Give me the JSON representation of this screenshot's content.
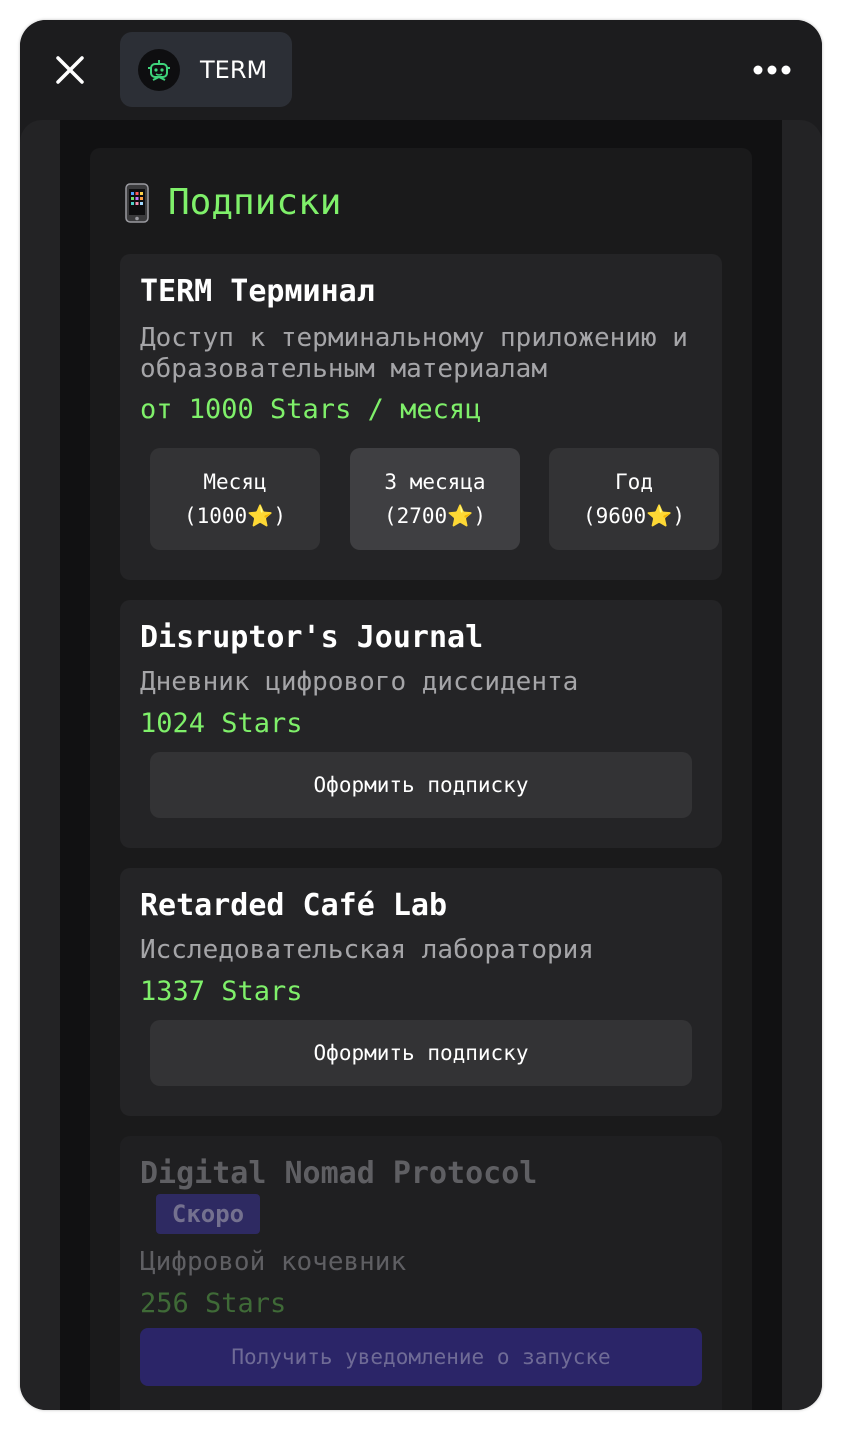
{
  "header": {
    "app_title": "TERM",
    "close_icon": "close-icon",
    "more_icon": "more-icon",
    "avatar_icon": "robot-avatar-icon"
  },
  "page": {
    "heading_icon": "mobile-phone-icon",
    "heading": "Подписки"
  },
  "colors": {
    "accent_green": "#7ff06a",
    "background": "#1a1a1b",
    "card": "#242426",
    "notify_button": "#2b2568"
  },
  "cards": [
    {
      "title": "TERM Терминал",
      "description": "Доступ к терминальному приложению и образовательным материалам",
      "price": "от 1000 Stars / месяц",
      "plans": [
        {
          "label": "Месяц",
          "price": "(1000⭐)"
        },
        {
          "label": "3 месяца",
          "price": "(2700⭐)",
          "selected": true
        },
        {
          "label": "Год",
          "price": "(9600⭐)"
        }
      ]
    },
    {
      "title": "Disruptor's Journal",
      "description": "Дневник цифрового диссидента",
      "price": "1024 Stars",
      "button": "Оформить подписку"
    },
    {
      "title": "Retarded Café Lab",
      "description": "Исследовательская лаборатория",
      "price": "1337 Stars",
      "button": "Оформить подписку"
    },
    {
      "title": "Digital Nomad Protocol",
      "badge": "Скоро",
      "description": "Цифровой кочевник",
      "price": "256 Stars",
      "button": "Получить уведомление о запуске"
    }
  ]
}
